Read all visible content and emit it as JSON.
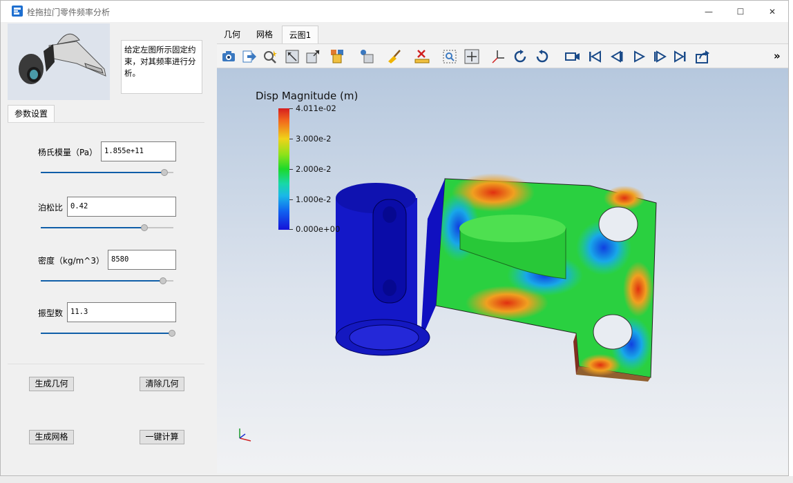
{
  "window": {
    "title": "栓拖拉门零件频率分析",
    "minimize_glyph": "—",
    "maximize_glyph": "☐",
    "close_glyph": "✕"
  },
  "left_panel": {
    "description": "给定左图所示固定约束，对其频率进行分析。",
    "param_tab": "参数设置",
    "params": [
      {
        "label": "杨氏模量（Pa）",
        "value": "1.855e+11",
        "slider": 0.93
      },
      {
        "label": "泊松比",
        "value": "0.42",
        "slider": 0.78
      },
      {
        "label": "密度（kg/m^3）",
        "value": "8580",
        "slider": 0.92
      },
      {
        "label": "振型数",
        "value": "11.3",
        "slider": 0.99
      }
    ],
    "buttons": {
      "gen_geometry": "生成几何",
      "clear_geometry": "清除几何",
      "gen_mesh": "生成网格",
      "compute": "一键计算"
    }
  },
  "tabs": [
    "几何",
    "网格",
    "云图1"
  ],
  "active_tab": "云图1",
  "toolbar": {
    "icons": [
      "camera-icon",
      "export-arrow-icon",
      "zoom-magic-icon",
      "fit-box-icon",
      "resize-box-icon",
      "display-mode-icon",
      "view-select-icon",
      "clean-brush-icon",
      "ruler-clear-icon",
      "zoom-window-icon",
      "pan-move-icon",
      "axes-icon",
      "rotate-right-icon",
      "rotate-left-icon",
      "video-camera-icon",
      "first-frame-icon",
      "prev-frame-icon",
      "play-icon",
      "next-frame-icon",
      "last-frame-icon",
      "export-share-icon"
    ],
    "overflow": "»"
  },
  "legend": {
    "title": "Disp Magnitude (m)",
    "ticks": [
      "4.011e-02",
      "3.000e-2",
      "2.000e-2",
      "1.000e-2",
      "0.000e+00"
    ],
    "colors": {
      "max": "#d61e1e",
      "mid": "#1cd92b",
      "min": "#1512d8"
    }
  }
}
